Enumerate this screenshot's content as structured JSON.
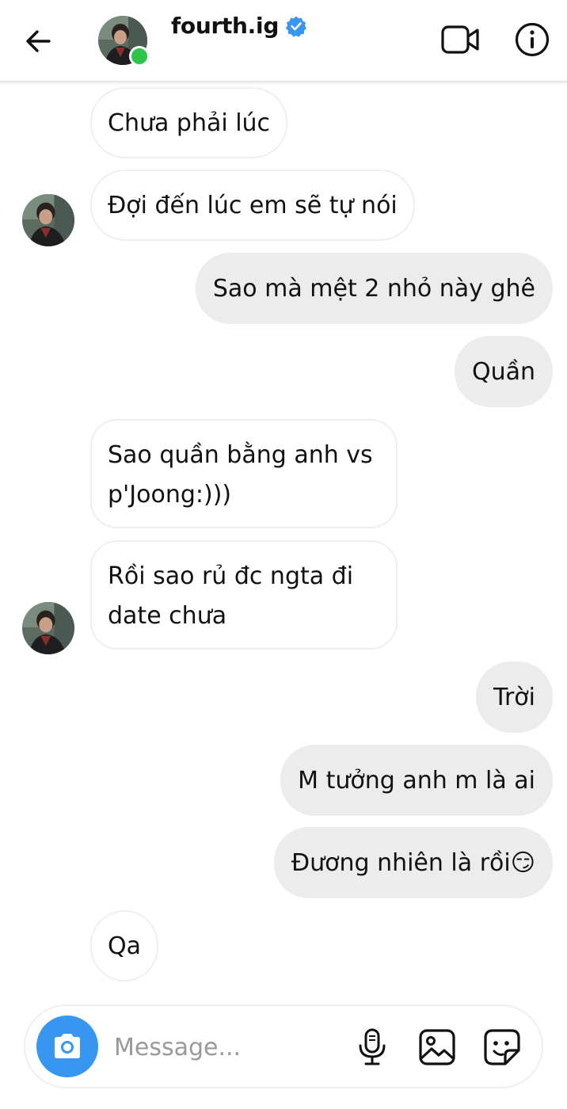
{
  "header": {
    "username": "fourth.ig",
    "verified": true,
    "online": true
  },
  "messages": [
    {
      "direction": "in",
      "text": "Chưa phải lúc"
    },
    {
      "direction": "in",
      "text": "Đợi đến lúc em sẽ tự nói",
      "avatar": true
    },
    {
      "direction": "out",
      "text": "Sao mà mệt 2 nhỏ này ghê"
    },
    {
      "direction": "out",
      "text": "Quần"
    },
    {
      "direction": "in",
      "text": "Sao quần bằng anh vs p'Joong:)))"
    },
    {
      "direction": "in",
      "text": "Rồi sao rủ đc ngta đi date chưa",
      "avatar": true
    },
    {
      "direction": "out",
      "text": "Trời"
    },
    {
      "direction": "out",
      "text": "M tưởng anh m là ai"
    },
    {
      "direction": "out",
      "text": "Đương nhiên là rồi",
      "emoji": "😏"
    },
    {
      "direction": "in",
      "text": "Qa"
    }
  ],
  "composer": {
    "placeholder": "Message..."
  },
  "icons": {
    "back": "arrow-left-icon",
    "verified": "verified-badge-icon",
    "video": "video-call-icon",
    "info": "info-icon",
    "camera": "camera-icon",
    "mic": "microphone-icon",
    "gallery": "image-gallery-icon",
    "sticker": "sticker-icon"
  },
  "colors": {
    "accent": "#3797f0",
    "online": "#2ec44a",
    "outgoing_bubble": "#ececec",
    "incoming_border": "#efefef"
  }
}
